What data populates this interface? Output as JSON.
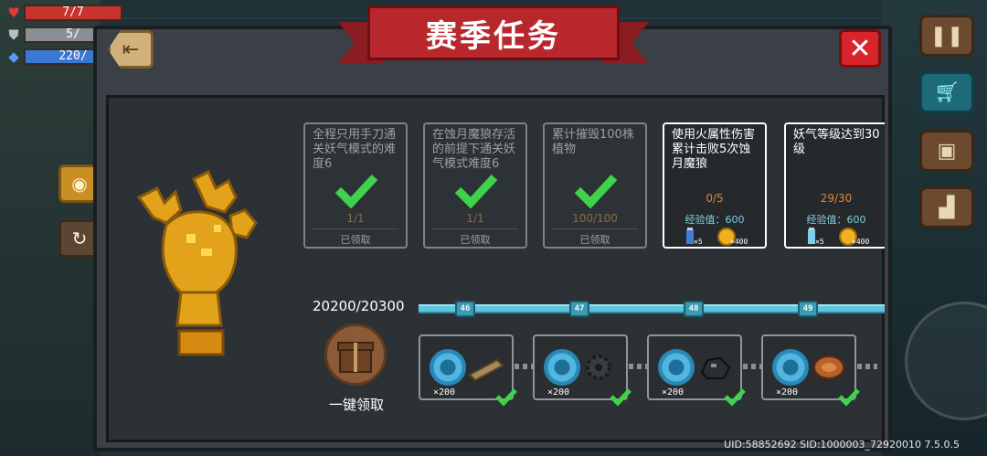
{
  "title": "赛季任务",
  "hud": {
    "hp": "7/7",
    "armor": "5/",
    "energy": "220/"
  },
  "quests": [
    {
      "text": "全程只用手刀通关妖气模式的难度6",
      "progress": "1/1",
      "status": "已领取",
      "state": "done"
    },
    {
      "text": "在蚀月魔狼存活的前提下通关妖气模式难度6",
      "progress": "1/1",
      "status": "已领取",
      "state": "done"
    },
    {
      "text": "累计摧毁100株植物",
      "progress": "100/100",
      "status": "已领取",
      "state": "done"
    },
    {
      "text": "使用火属性伤害累计击败5次蚀月魔狼",
      "progress": "0/5",
      "exp": "经验值：600",
      "reward1_qty": "×5",
      "reward2_qty": "×400",
      "state": "active"
    },
    {
      "text": "妖气等级达到30级",
      "progress": "29/30",
      "exp": "经验值：600",
      "reward1_qty": "×5",
      "reward2_qty": "×400",
      "state": "active"
    }
  ],
  "season_exp": "20200/20300",
  "claim_all_label": "一键领取",
  "levels": [
    {
      "level": "46",
      "gem_qty": "×200",
      "item": "wood-plank-icon",
      "claimed": true
    },
    {
      "level": "47",
      "gem_qty": "×200",
      "item": "gear-part-icon",
      "claimed": true
    },
    {
      "level": "48",
      "gem_qty": "×200",
      "item": "coal-ore-icon",
      "claimed": true
    },
    {
      "level": "49",
      "gem_qty": "×200",
      "item": "meat-icon",
      "claimed": true
    }
  ],
  "footer_uid": "UID:58852692 SID:1000003_72920010 7.5.0.5",
  "colors": {
    "ribbon": "#b8272c",
    "check": "#3fd24a",
    "track": "#5fc6de",
    "progress_orange": "#e0843a"
  }
}
